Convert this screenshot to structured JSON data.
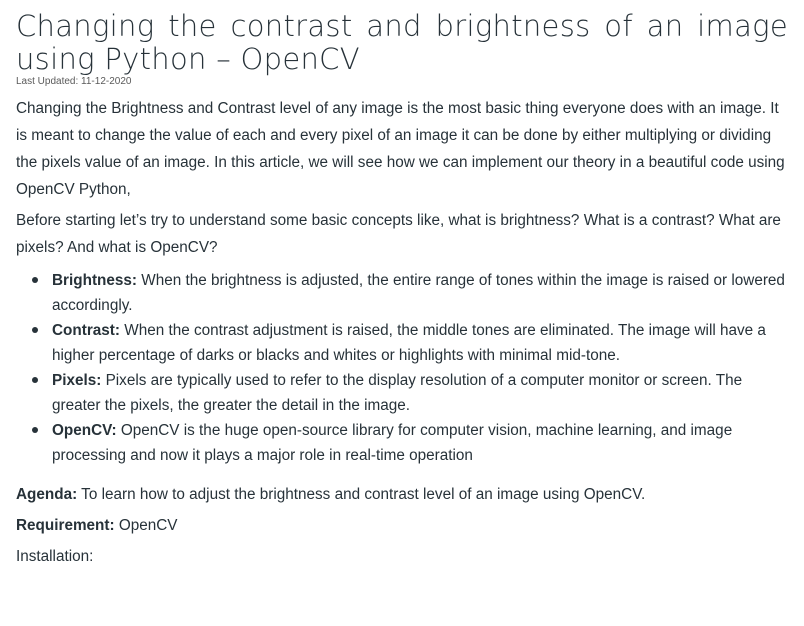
{
  "article": {
    "title": "Changing the contrast and brightness of an image using Python – OpenCV",
    "last_updated": "Last Updated: 11-12-2020",
    "intro": "Changing the Brightness and Contrast level of any image is the most basic thing everyone does with an image. It is meant to change the value of each and every pixel of an image it can be done by either multiplying or dividing the pixels value of an image. In this article, we will see how we can implement our theory in a beautiful code using OpenCV Python,",
    "before": "Before starting let’s try to understand some basic concepts like, what is brightness? What is a contrast? What are pixels? And what is OpenCV?",
    "concepts": [
      {
        "term": "Brightness:",
        "text": " When the brightness is adjusted, the entire range of tones within the image is raised or lowered accordingly."
      },
      {
        "term": "Contrast:",
        "text": " When the contrast adjustment is raised, the middle tones are eliminated. The image will have a higher percentage of darks or blacks and whites or highlights with minimal mid-tone."
      },
      {
        "term": "Pixels:",
        "text": " Pixels are typically used to refer to the display resolution of a computer monitor or screen. The greater the pixels, the greater the detail in the image."
      },
      {
        "term": "OpenCV:",
        "text": " OpenCV is the huge open-source library for computer vision, machine learning, and image processing and now it plays a major role in real-time operation"
      }
    ],
    "agenda_label": "Agenda:",
    "agenda_text": " To learn how to adjust the brightness and contrast level of an image using OpenCV.",
    "requirement_label": "Requirement:",
    "requirement_text": " OpenCV",
    "installation": "Installation:"
  }
}
